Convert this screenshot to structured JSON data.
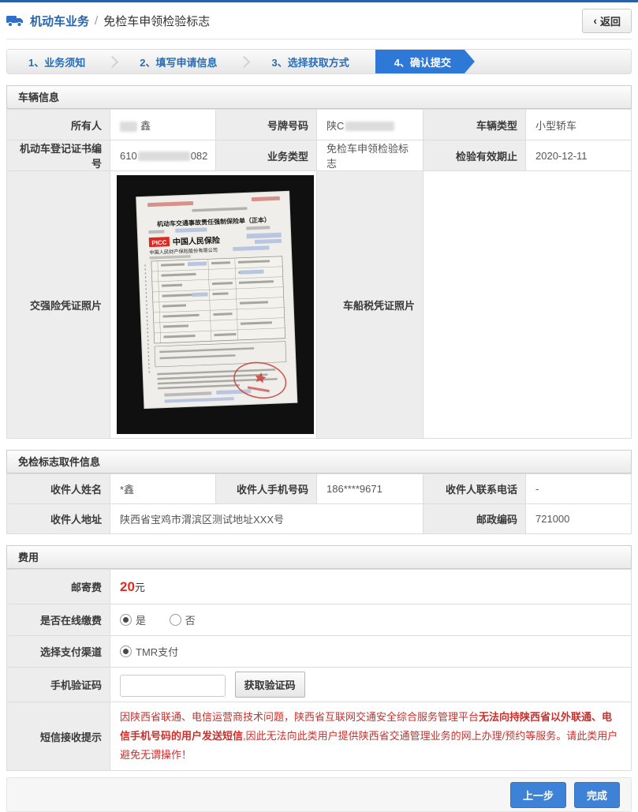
{
  "colors": {
    "top_border_blue": "#2563a6",
    "accent_blue": "#2e79d8",
    "button_blue": "#3e82d8",
    "brand_red": "#e0281e",
    "notice_red": "#c9302c",
    "fee_red": "#e02b20"
  },
  "header": {
    "module_title": "机动车业务",
    "separator": "/",
    "page_title": "免检车申领检验标志",
    "back_chevron": "‹",
    "back_label": "返回"
  },
  "steps": {
    "step1": "1、业务须知",
    "step2": "2、填写申请信息",
    "step3": "3、选择获取方式",
    "step4": "4、确认提交"
  },
  "vehicle_info": {
    "section_title": "车辆信息",
    "owner_label": "所有人",
    "owner_value": "鑫",
    "plate_label": "号牌号码",
    "plate_value": "陕C",
    "type_label": "车辆类型",
    "type_value": "小型轿车",
    "regcert_label": "机动车登记证书编号",
    "regcert_prefix": "610",
    "regcert_suffix": "082",
    "biztype_label": "业务类型",
    "biztype_value": "免检车申领检验标志",
    "validity_label": "检验有效期止",
    "validity_value": "2020-12-11",
    "insurance_photo_label": "交强险凭证照片",
    "tax_photo_label": "车船税凭证照片",
    "photo": {
      "doc_title": "机动车交通事故责任强制保险单（正本）",
      "brand_abbr": "PICC",
      "brand_name": "中国人民保险",
      "company": "中国人民财产保险股份有限公司"
    }
  },
  "pickup_info": {
    "section_title": "免检标志取件信息",
    "name_label": "收件人姓名",
    "name_value": "*鑫",
    "mobile_label": "收件人手机号码",
    "mobile_value": "186****9671",
    "phone_label": "收件人联系电话",
    "phone_value": "-",
    "address_label": "收件人地址",
    "address_value": "陕西省宝鸡市渭滨区测试地址XXX号",
    "postcode_label": "邮政编码",
    "postcode_value": "721000"
  },
  "fee": {
    "section_title": "费用",
    "postage_label": "邮寄费",
    "postage_amount": "20",
    "postage_unit": "元",
    "online_pay_label": "是否在线缴费",
    "online_pay_yes": "是",
    "online_pay_no": "否",
    "channel_label": "选择支付渠道",
    "channel_option": "TMR支付",
    "sms_code_label": "手机验证码",
    "get_code_label": "获取验证码",
    "notice_label": "短信接收提示",
    "notice_part1": "因陕西省联通、电信运营商技术问题，陕西省互联网交通安全综合服务管理平台",
    "notice_part2": "无法向持陕西省以外联通、电信手机号码的用户发送短信",
    "notice_part3": ",因此无法向此类用户提供陕西省交通管理业务的网上办理/预约等服务。请此类用户避免无谓操作！"
  },
  "footer": {
    "prev_label": "上一步",
    "finish_label": "完成"
  }
}
